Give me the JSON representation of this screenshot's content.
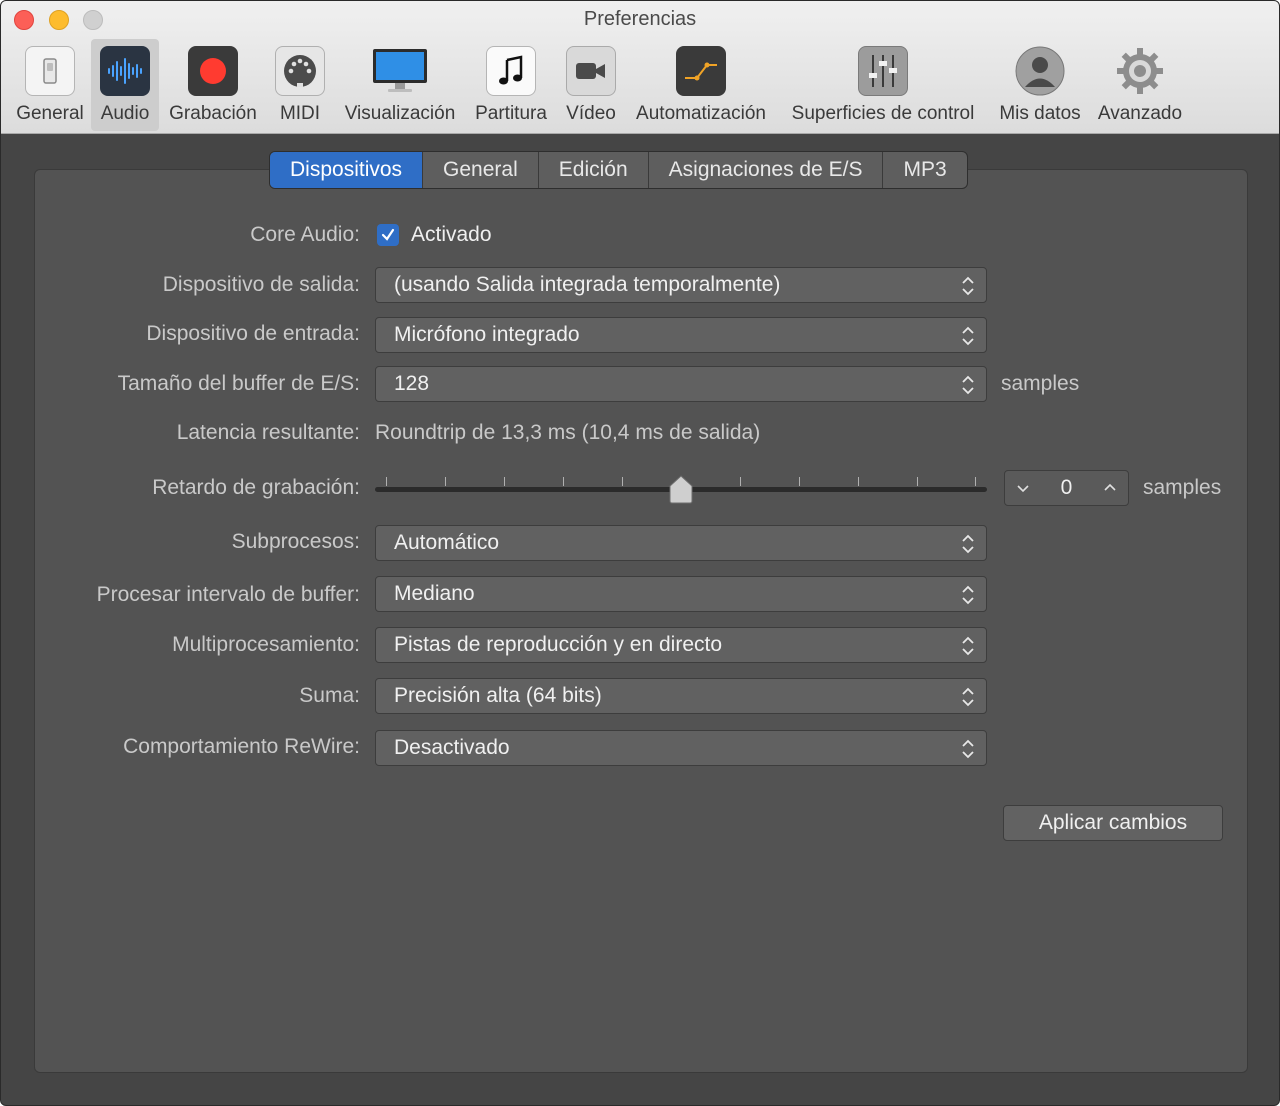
{
  "window": {
    "title": "Preferencias"
  },
  "toolbar": {
    "items": [
      {
        "label": "General",
        "icon": "switch-icon"
      },
      {
        "label": "Audio",
        "icon": "waveform-icon",
        "selected": true
      },
      {
        "label": "Grabación",
        "icon": "record-icon"
      },
      {
        "label": "MIDI",
        "icon": "midi-connector-icon"
      },
      {
        "label": "Visualización",
        "icon": "monitor-icon"
      },
      {
        "label": "Partitura",
        "icon": "music-note-icon"
      },
      {
        "label": "Vídeo",
        "icon": "video-camera-icon"
      },
      {
        "label": "Automatización",
        "icon": "automation-curve-icon"
      },
      {
        "label": "Superficies de control",
        "icon": "faders-icon"
      },
      {
        "label": "Mis datos",
        "icon": "user-silhouette-icon"
      },
      {
        "label": "Avanzado",
        "icon": "gear-icon"
      }
    ]
  },
  "tabs": [
    {
      "label": "Dispositivos",
      "active": true
    },
    {
      "label": "General"
    },
    {
      "label": "Edición"
    },
    {
      "label": "Asignaciones de E/S"
    },
    {
      "label": "MP3"
    }
  ],
  "form": {
    "core_audio": {
      "label": "Core Audio:",
      "checkbox_label": "Activado",
      "checked": true
    },
    "output_device": {
      "label": "Dispositivo de salida:",
      "value": "(usando Salida integrada temporalmente)"
    },
    "input_device": {
      "label": "Dispositivo de entrada:",
      "value": "Micrófono integrado"
    },
    "buffer_size": {
      "label": "Tamaño del buffer de E/S:",
      "value": "128",
      "unit": "samples"
    },
    "latency": {
      "label": "Latencia resultante:",
      "value": "Roundtrip de 13,3 ms (10,4 ms de salida)"
    },
    "recording_delay": {
      "label": "Retardo de grabación:",
      "value": "0",
      "unit": "samples",
      "slider_position": 0.5
    },
    "threads": {
      "label": "Subprocesos:",
      "value": "Automático"
    },
    "process_buffer_range": {
      "label": "Procesar intervalo de buffer:",
      "value": "Mediano"
    },
    "multiprocessing": {
      "label": "Multiprocesamiento:",
      "value": "Pistas de reproducción y en directo"
    },
    "summing": {
      "label": "Suma:",
      "value": "Precisión alta (64 bits)"
    },
    "rewire": {
      "label": "Comportamiento ReWire:",
      "value": "Desactivado"
    }
  },
  "apply_button": {
    "label": "Aplicar cambios"
  },
  "colors": {
    "accent": "#2f6ec6",
    "background": "#454545",
    "panel": "#535353"
  }
}
